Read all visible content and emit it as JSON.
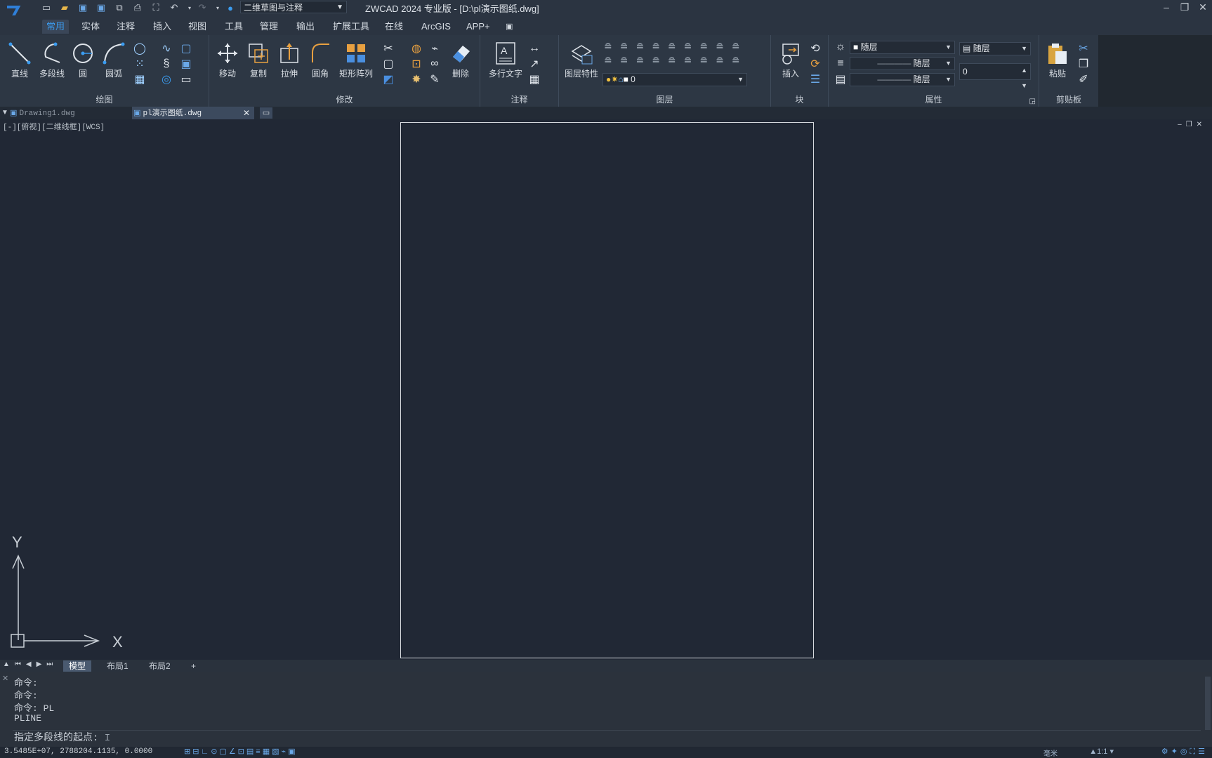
{
  "app": {
    "title": "ZWCAD 2024 专业版 - [D:\\pl演示图纸.dwg]",
    "workspace": "二维草图与注释"
  },
  "menu": {
    "tabs": [
      "常用",
      "实体",
      "注释",
      "插入",
      "视图",
      "工具",
      "管理",
      "输出",
      "扩展工具",
      "在线",
      "ArcGIS",
      "APP+"
    ],
    "active": "常用"
  },
  "ribbon": {
    "draw": {
      "label": "绘图",
      "line": "直线",
      "polyline": "多段线",
      "circle": "圆",
      "arc": "圆弧"
    },
    "modify": {
      "label": "修改",
      "move": "移动",
      "copy": "复制",
      "stretch": "拉伸",
      "fillet": "圆角",
      "array": "矩形阵列",
      "erase": "删除"
    },
    "annotation": {
      "label": "注释",
      "mtext": "多行文字"
    },
    "layers": {
      "label": "图层",
      "properties": "图层特性",
      "current_layer": "0"
    },
    "block": {
      "label": "块",
      "insert": "插入"
    },
    "properties": {
      "label": "属性",
      "color": "随层",
      "linetype": "随层",
      "lineweight": "随层",
      "plotstyle": "随层",
      "transparency": "0"
    },
    "clipboard": {
      "label": "剪贴板",
      "paste": "粘贴"
    }
  },
  "doc_tabs": [
    {
      "name": "Drawing1.dwg",
      "active": false
    },
    {
      "name": "pl演示图纸.dwg",
      "active": true
    }
  ],
  "viewport": {
    "label": "[-][俯视][二维线框][WCS]",
    "ucs_x": "X",
    "ucs_y": "Y"
  },
  "layout_tabs": [
    "模型",
    "布局1",
    "布局2",
    "+"
  ],
  "command": {
    "history": [
      "命令:",
      "命令:",
      "命令: PL",
      "PLINE"
    ],
    "prompt": "指定多段线的起点:"
  },
  "status": {
    "coords": "3.5485E+07,  2788204.1135,  0.0000",
    "scale": "1:1",
    "units": "毫米"
  },
  "colors": {
    "accent": "#3b9cf0",
    "background": "#212835"
  }
}
